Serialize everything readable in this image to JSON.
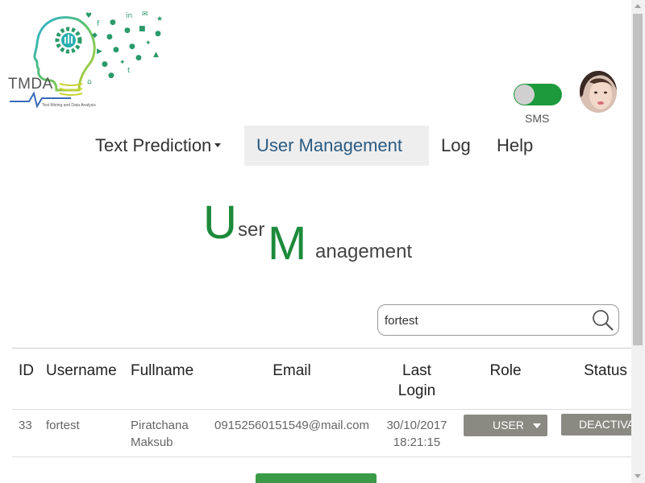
{
  "logo": {
    "name": "TMDA",
    "tagline": "Text Mining and Data Analysis"
  },
  "header": {
    "sms_label": "SMS",
    "sms_toggle_on": true,
    "accent_color": "#1c9a3c"
  },
  "nav": {
    "items": [
      {
        "label": "Text Prediction",
        "has_dropdown": true
      },
      {
        "label": "User Management",
        "active": true
      },
      {
        "label": "Log"
      },
      {
        "label": "Help"
      }
    ]
  },
  "page_title": {
    "letter1": "U",
    "word1": "ser",
    "letter2": "M",
    "word2": "anagement"
  },
  "search": {
    "value": "fortest",
    "icon": "search-icon"
  },
  "table": {
    "headers": {
      "id": "ID",
      "username": "Username",
      "fullname": "Fullname",
      "email": "Email",
      "last_login_1": "Last",
      "last_login_2": "Login",
      "role": "Role",
      "status": "Status"
    },
    "rows": [
      {
        "id": "33",
        "username": "fortest",
        "fullname_1": "Piratchana",
        "fullname_2": "Maksub",
        "email": "09152560151549@mail.com",
        "last_login_1": "30/10/2017",
        "last_login_2": "18:21:15",
        "role": "USER",
        "status_action": "DEACTIVATE"
      }
    ]
  },
  "colors": {
    "button_gray": "#8a8a82",
    "title_green": "#1c8a3a",
    "nav_active": "#2a5a82"
  }
}
